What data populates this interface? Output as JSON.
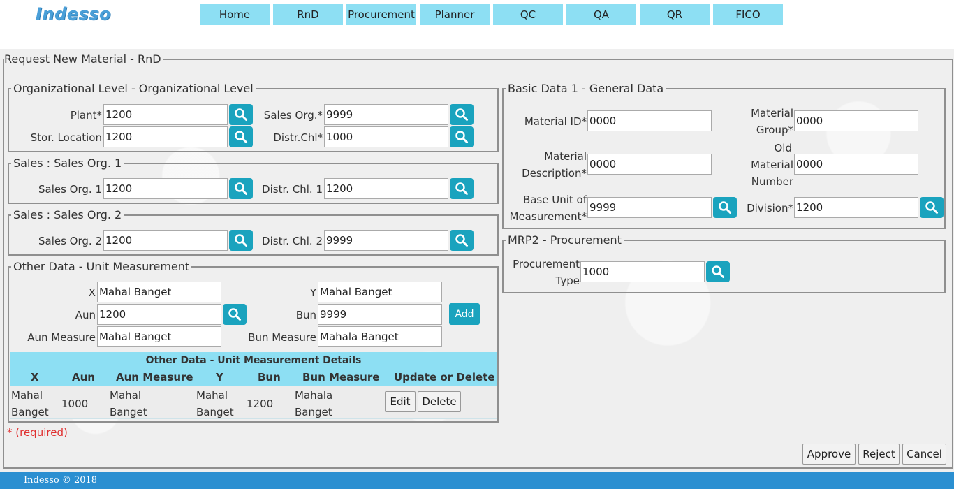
{
  "header": {
    "logo": "Indesso",
    "nav": [
      "Home",
      "RnD",
      "Procurement",
      "Planner",
      "QC",
      "QA",
      "QR",
      "FICO"
    ]
  },
  "page": {
    "title": "Request New Material - RnD"
  },
  "org_level": {
    "legend": "Organizational Level - Organizational Level",
    "plant_label": "Plant*",
    "plant_value": "1200",
    "sales_org_label": "Sales Org.*",
    "sales_org_value": "9999",
    "stor_location_label": "Stor. Location",
    "stor_location_value": "1200",
    "distr_chl_label": "Distr.Chl*",
    "distr_chl_value": "1000"
  },
  "sales1": {
    "legend": "Sales : Sales Org. 1",
    "sales_org_label": "Sales Org. 1",
    "sales_org_value": "1200",
    "distr_chl_label": "Distr. Chl. 1",
    "distr_chl_value": "1200"
  },
  "sales2": {
    "legend": "Sales : Sales Org. 2",
    "sales_org_label": "Sales Org. 2",
    "sales_org_value": "1200",
    "distr_chl_label": "Distr. Chl. 2",
    "distr_chl_value": "9999"
  },
  "other_data": {
    "legend": "Other Data - Unit Measurement",
    "x_label": "X",
    "x_value": "Mahal Banget",
    "y_label": "Y",
    "y_value": "Mahal Banget",
    "aun_label": "Aun",
    "aun_value": "1200",
    "bun_label": "Bun",
    "bun_value": "9999",
    "aun_measure_label": "Aun Measure",
    "aun_measure_value": "Mahal Banget",
    "bun_measure_label": "Bun Measure",
    "bun_measure_value": "Mahala Banget",
    "add_label": "Add"
  },
  "details_table": {
    "title": "Other Data - Unit Measurement Details",
    "columns": [
      "X",
      "Aun",
      "Aun Measure",
      "Y",
      "Bun",
      "Bun Measure",
      "Update or Delete"
    ],
    "row": {
      "x": "Mahal Banget",
      "aun": "1000",
      "aun_measure": "Mahal Banget",
      "y": "Mahal Banget",
      "bun": "1200",
      "bun_measure": "Mahala Banget",
      "edit_label": "Edit",
      "delete_label": "Delete"
    }
  },
  "required_note": "* (required)",
  "basic_data": {
    "legend": "Basic Data 1 - General Data",
    "material_id_label": "Material ID*",
    "material_id_value": "0000",
    "material_group_label_1": "Material",
    "material_group_label_2": "Group*",
    "material_group_value": "0000",
    "material_desc_label_1": "Material",
    "material_desc_label_2": "Description*",
    "material_desc_value": "0000",
    "old_material_label_1": "Old",
    "old_material_label_2": "Material",
    "old_material_label_3": "Number",
    "old_material_value": "0000",
    "base_unit_label_1": "Base Unit of",
    "base_unit_label_2": "Measurement*",
    "base_unit_value": "9999",
    "division_label": "Division*",
    "division_value": "1200"
  },
  "mrp2": {
    "legend": "MRP2 - Procurement",
    "procurement_type_label_1": "Procurement",
    "procurement_type_label_2": "Type",
    "procurement_type_value": "1000"
  },
  "actions": {
    "approve": "Approve",
    "reject": "Reject",
    "cancel": "Cancel"
  },
  "footer": {
    "text": "Indesso © 2018"
  },
  "colors": {
    "nav_bg": "#8ddff3",
    "search_btn": "#1aa3be",
    "footer_bg": "#2b8fd1",
    "required": "#e03030"
  }
}
